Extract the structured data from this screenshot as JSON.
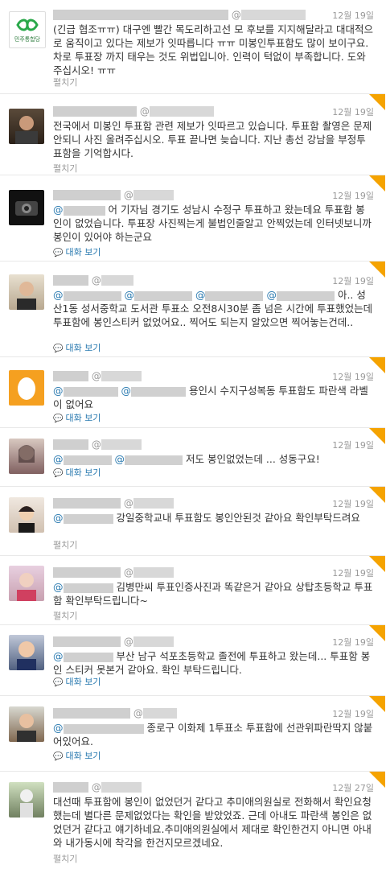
{
  "accent": "#2a7ab0",
  "tweets": [
    {
      "time": "12월 19일",
      "text": "(긴급 협조ㅠㅠ) 대구엔 빨간 목도리하고선 모 후보를 지지해달라고 대대적으로 움직이고 있다는 제보가 잇따릅니다 ㅠㅠ 미봉인투표함도 많이 보이구요. 차로 투표장 까지 태우는 것도 위법입니아. 인력이 턱없이 부족합니다. 도와주십시오! ㅠㅠ",
      "prefix": "",
      "action": "펼치기",
      "avatar_text": "민주통합당"
    },
    {
      "time": "12월 19일",
      "text": "전국에서 미봉인 투표함 관련 제보가 잇따르고 있습니다. 투표함 촬영은 문제 안되니 사진 올려주십시오. 투표 끝나면 늦습니다. 지난 총선 강남을 부정투표함을 기억합시다.",
      "prefix": "",
      "action": "펼치기"
    },
    {
      "time": "12월 19일",
      "text": "어 기자님 경기도 성남시 수정구 투표하고 왔는데요 투표함 봉인이 없었습니다. 투표장 사진찍는게 불법인줄알고 안찍었는데 인터넷보니까 봉인이 있어야 하는군요",
      "prefix": "@",
      "action": "대화 보기"
    },
    {
      "time": "12월 19일",
      "text": "아.. 성산1동 성서중학교 도서관 투표소 오전8시30분 좀 넘은 시간에 투표했었는데 투표함에 봉인스티커 없었어요.. 찍어도 되는지 알았으면 찍어놓는건데..",
      "prefix": "@",
      "action": "대화 보기"
    },
    {
      "time": "12월 19일",
      "text": "용인시 수지구성복동 투표함도 파란색 라벨이 없어요",
      "prefix": "@",
      "action": "대화 보기"
    },
    {
      "time": "12월 19일",
      "text": "저도 봉인없었는데 ... 성동구요!",
      "prefix": "@",
      "action": "대화 보기"
    },
    {
      "time": "12월 19일",
      "text": "강일중학교내 투표함도 봉인안된것 같아요 확인부탁드려요",
      "prefix": "@",
      "action": "펼치기"
    },
    {
      "time": "12월 19일",
      "text": "김병만씨 투표인증사진과 똑같은거 같아요 상탑초등학교 투표함 확인부탁드립니다~",
      "prefix": "@",
      "action": "펼치기"
    },
    {
      "time": "12월 19일",
      "text": "부산 남구 석포초등학교 졸전에 투표하고 왔는데... 투표함 봉인 스티커 못본거 같아요. 확인 부탁드립니다.",
      "prefix": "@",
      "action": "대화 보기"
    },
    {
      "time": "12월 19일",
      "text": "종로구 이화제 1투표소 투표함에 선관위파란딱지 않붙어있어요.",
      "prefix": "@",
      "action": "대화 보기"
    },
    {
      "time": "12월 27일",
      "text": "대선때 투표함에 봉인이 없었던거 같다고 추미애의원실로 전화해서 확인요청했는데 별다른 문제없었다는 확인을 받았었죠. 근데 아내도 파란색 봉인은 없었던거 같다고 얘기하네요.추미애의원실에서 제대로 확인한건지 아니면 아내와 내가동시에 착각을 한건지모르겠네요.",
      "prefix": "",
      "action": "펼치기"
    }
  ]
}
